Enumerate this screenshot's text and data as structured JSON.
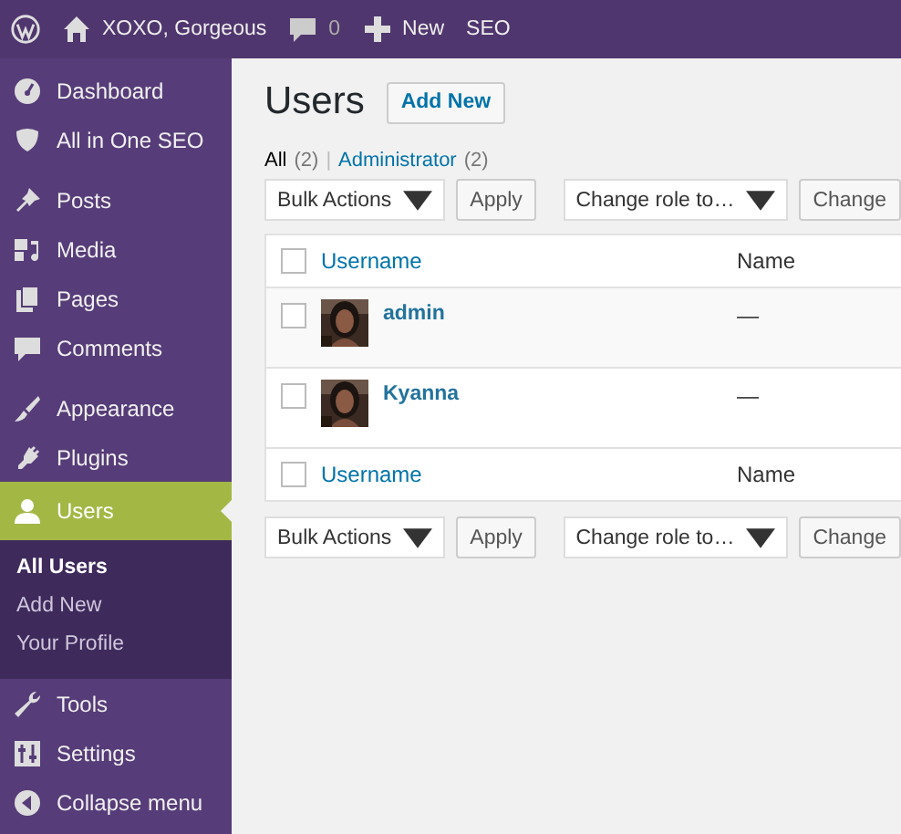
{
  "admin_bar": [
    {
      "kind": "logo"
    },
    {
      "kind": "site",
      "label": "XOXO, Gorgeous"
    },
    {
      "kind": "comments",
      "label": "0"
    },
    {
      "kind": "new",
      "label": "New"
    },
    {
      "kind": "text",
      "label": "SEO"
    }
  ],
  "sidebar": {
    "groups": [
      [
        {
          "label": "Dashboard",
          "selected": false
        },
        {
          "label": "All in One SEO",
          "selected": false
        }
      ],
      [
        {
          "label": "Posts",
          "selected": false
        },
        {
          "label": "Media",
          "selected": false
        },
        {
          "label": "Pages",
          "selected": false
        },
        {
          "label": "Comments",
          "selected": false
        }
      ],
      [
        {
          "label": "Appearance",
          "selected": false
        },
        {
          "label": "Plugins",
          "selected": false
        },
        {
          "label": "Users",
          "selected": true,
          "children": [
            {
              "label": "All Users",
              "selected": true
            },
            {
              "label": "Add New",
              "selected": false
            },
            {
              "label": "Your Profile",
              "selected": false
            }
          ]
        },
        {
          "label": "Tools",
          "selected": false
        },
        {
          "label": "Settings",
          "selected": false
        },
        {
          "label": "Collapse menu",
          "selected": false
        }
      ]
    ]
  },
  "page": {
    "title": "Users",
    "add_new": "Add New",
    "filter_separator": "|",
    "filters": [
      {
        "label": "All",
        "count": "(2)",
        "selected": true
      },
      {
        "label": "Administrator",
        "count": "(2)",
        "selected": false
      }
    ],
    "tablenav_top": {
      "bulk": "Bulk Actions",
      "apply": "Apply",
      "role": "Change role to…",
      "change": "Change"
    },
    "table": {
      "columns": [
        "Username",
        "Name"
      ],
      "header_checked": false,
      "rows": [
        {
          "username": "admin",
          "name": "—",
          "checked": false
        },
        {
          "username": "Kyanna",
          "name": "—",
          "checked": false
        }
      ],
      "footer_columns": [
        "Username",
        "Name"
      ],
      "footer_checked": false
    },
    "tablenav_bottom": {
      "bulk": "Bulk Actions",
      "apply": "Apply",
      "role": "Change role to…",
      "change": "Change"
    }
  }
}
